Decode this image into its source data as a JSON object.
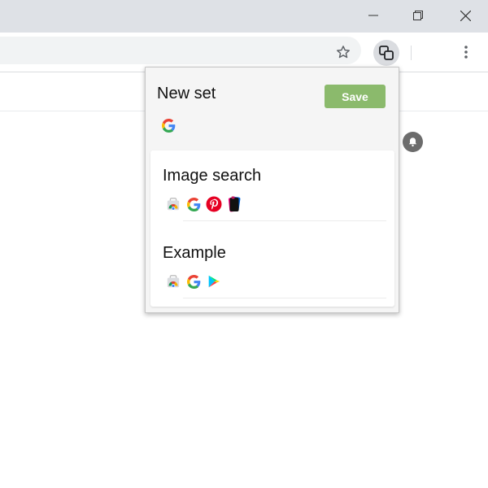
{
  "window": {
    "controls": [
      "minimize-icon",
      "restore-icon",
      "close-icon"
    ]
  },
  "toolbar": {
    "icons": [
      "star-icon",
      "extension-icon",
      "menu-dots-icon"
    ]
  },
  "popup": {
    "new_set": {
      "title": "New set",
      "save_label": "Save",
      "icons": [
        "google-icon"
      ]
    },
    "sets": [
      {
        "title": "Image search",
        "icons": [
          "chrome-web-store-icon",
          "google-icon",
          "pinterest-icon",
          "flickr-icon"
        ]
      },
      {
        "title": "Example",
        "icons": [
          "chrome-web-store-icon",
          "google-icon",
          "google-play-icon"
        ]
      }
    ]
  },
  "colors": {
    "titlebar": "#dee1e6",
    "save_button": "#8bba6c",
    "popup_background": "#f5f5f5"
  }
}
